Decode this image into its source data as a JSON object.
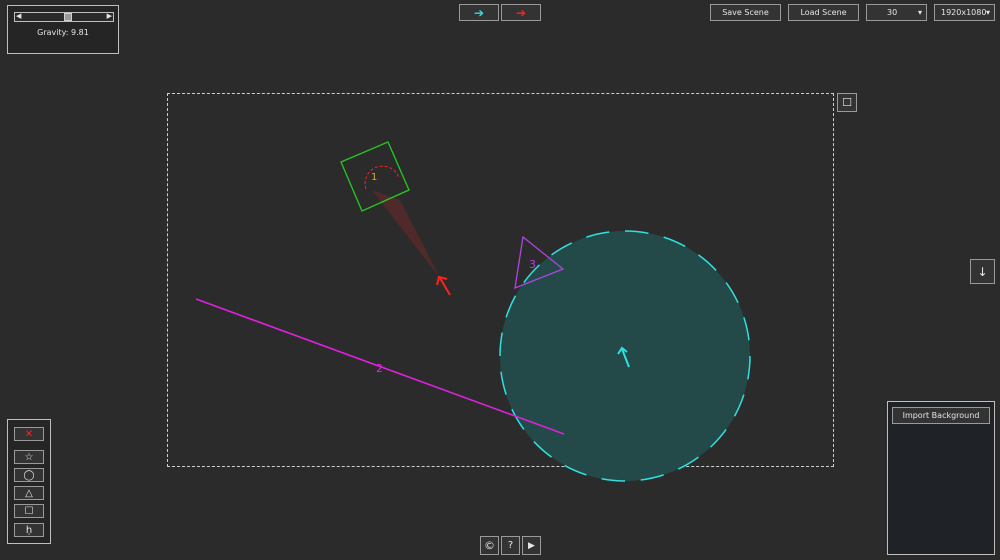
{
  "gravity": {
    "label": "Gravity: 9.81 ",
    "value_fraction": 0.55,
    "left_arrow": "◀",
    "right_arrow": "▶"
  },
  "direction_buttons": {
    "forward": "➔",
    "back": "➔"
  },
  "toolbar": {
    "save_label": "Save Scene",
    "load_label": "Load Scene",
    "fps_value": "30",
    "resolution_value": "1920x1080",
    "caret": "▾"
  },
  "side_buttons": {
    "toggle": "☐",
    "down": "↓"
  },
  "tools": {
    "delete": "✕",
    "star": "☆",
    "circle": "◯",
    "triangle": "△",
    "square": "☐",
    "ground": "ḥ"
  },
  "background_panel": {
    "import_label": "Import Background"
  },
  "bottom_bar": {
    "copyright": "©",
    "help": "?",
    "play": "▶"
  },
  "scene": {
    "labels": {
      "square": "1",
      "line": "2",
      "triangle": "3"
    },
    "colors": {
      "square": "#22cc22",
      "line": "#dd22dd",
      "triangle": "#b044e0",
      "circle_fill": "#234a48",
      "circle_stroke": "#2fe0e0",
      "arrow_red": "#ff2020",
      "arrow_cyan": "#2fe0e0"
    }
  }
}
